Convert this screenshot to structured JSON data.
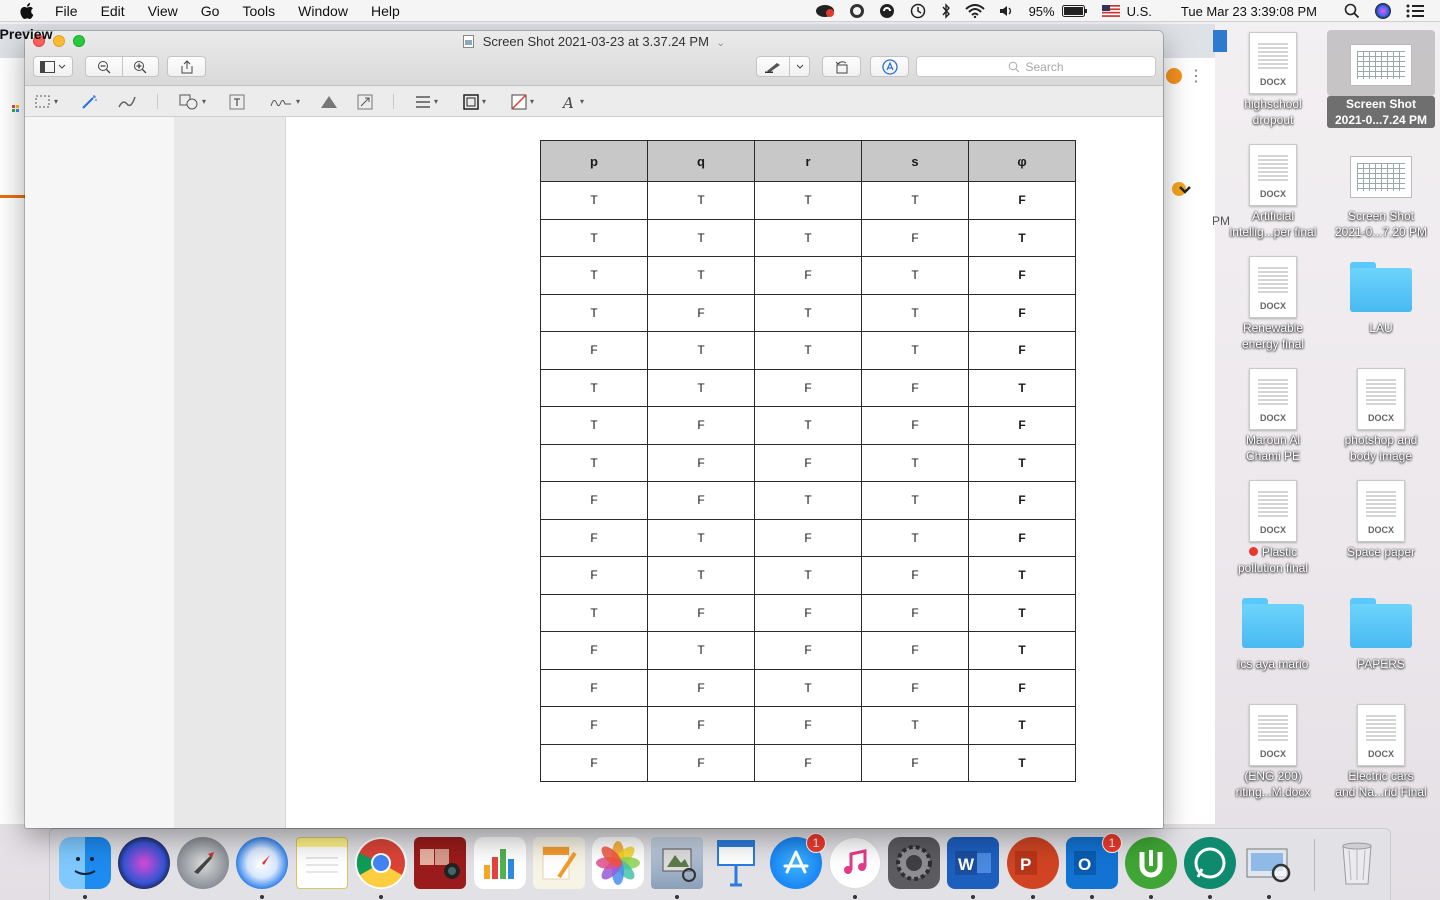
{
  "menubar": {
    "app_name": "Preview",
    "menus": [
      "File",
      "Edit",
      "View",
      "Go",
      "Tools",
      "Window",
      "Help"
    ],
    "battery": "95%",
    "input_source": "U.S.",
    "datetime": "Tue Mar 23  3:39:08 PM"
  },
  "window": {
    "title": "Screen Shot 2021-03-23 at 3.37.24 PM",
    "search_placeholder": "Search"
  },
  "table": {
    "headers": [
      "p",
      "q",
      "r",
      "s",
      "φ"
    ],
    "rows": [
      [
        "T",
        "T",
        "T",
        "T",
        "F"
      ],
      [
        "T",
        "T",
        "T",
        "F",
        "T"
      ],
      [
        "T",
        "T",
        "F",
        "T",
        "F"
      ],
      [
        "T",
        "F",
        "T",
        "T",
        "F"
      ],
      [
        "F",
        "T",
        "T",
        "T",
        "F"
      ],
      [
        "T",
        "T",
        "F",
        "F",
        "T"
      ],
      [
        "T",
        "F",
        "T",
        "F",
        "F"
      ],
      [
        "T",
        "F",
        "F",
        "T",
        "T"
      ],
      [
        "F",
        "F",
        "T",
        "T",
        "F"
      ],
      [
        "F",
        "T",
        "F",
        "T",
        "F"
      ],
      [
        "F",
        "T",
        "T",
        "F",
        "T"
      ],
      [
        "T",
        "F",
        "F",
        "F",
        "T"
      ],
      [
        "F",
        "T",
        "F",
        "F",
        "T"
      ],
      [
        "F",
        "F",
        "T",
        "F",
        "F"
      ],
      [
        "F",
        "F",
        "F",
        "T",
        "T"
      ],
      [
        "F",
        "F",
        "F",
        "F",
        "T"
      ]
    ]
  },
  "desktop": {
    "items": [
      {
        "label1": "highschool",
        "label2": "dropout",
        "kind": "DOCX"
      },
      {
        "label1": "Screen Shot",
        "label2": "2021-0...7.24 PM",
        "kind": "screenshot",
        "selected": true
      },
      {
        "label1": "Artificial",
        "label2": "intellig...per final",
        "kind": "DOCX"
      },
      {
        "label1": "Screen Shot",
        "label2": "2021-0...7.20 PM",
        "kind": "screenshot"
      },
      {
        "label1": "Renewable",
        "label2": "energy final",
        "kind": "DOCX"
      },
      {
        "label1": "LAU",
        "label2": "",
        "kind": "folder"
      },
      {
        "label1": "Maroun Al",
        "label2": "Chami PE",
        "kind": "DOCX"
      },
      {
        "label1": "photshop and",
        "label2": "body image",
        "kind": "DOCX"
      },
      {
        "label1": "Plastic",
        "label2": "pollution final",
        "kind": "DOCX"
      },
      {
        "label1": "Space paper",
        "label2": "",
        "kind": "DOCX"
      },
      {
        "label1": "ics aya mario",
        "label2": "",
        "kind": "folder"
      },
      {
        "label1": "PAPERS",
        "label2": "",
        "kind": "folder"
      },
      {
        "label1": "(ENG 200)",
        "label2": "riting...M.docx",
        "kind": "DOCX"
      },
      {
        "label1": "Electric cars",
        "label2": "and Na...rid Final",
        "kind": "DOCX"
      }
    ],
    "docx_tag": "DOCX"
  },
  "dock": {
    "badges": {
      "app_store": "1",
      "outlook": "1"
    }
  },
  "background": {
    "fragment": "PM"
  },
  "colors": {
    "accent_orange": "#e8710a",
    "selection_gray": "#6f6f6f",
    "table_header_bg": "#c8c8c8"
  }
}
